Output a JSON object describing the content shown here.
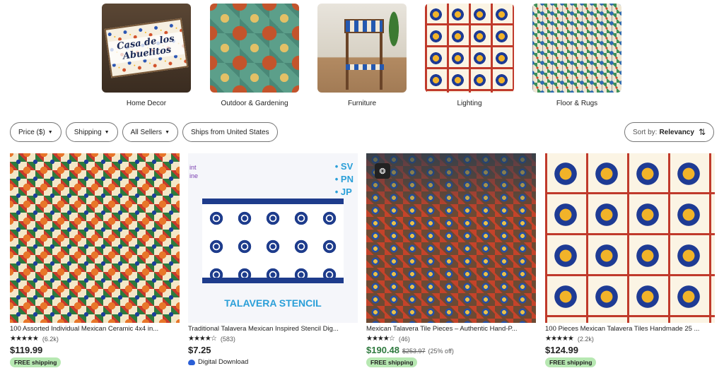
{
  "categories": [
    {
      "label": "Home Decor",
      "sign_text": "Casa de los Abuelitos"
    },
    {
      "label": "Outdoor & Gardening"
    },
    {
      "label": "Furniture"
    },
    {
      "label": "Lighting"
    },
    {
      "label": "Floor & Rugs"
    }
  ],
  "filters": [
    {
      "label": "Price ($)",
      "has_caret": true
    },
    {
      "label": "Shipping",
      "has_caret": true
    },
    {
      "label": "All Sellers",
      "has_caret": true
    },
    {
      "label": "Ships from United States",
      "has_caret": false
    }
  ],
  "sort": {
    "prefix": "Sort by:",
    "value": "Relevancy",
    "icon": "sort-arrows-icon"
  },
  "listings": [
    {
      "title": "100 Assorted Individual Mexican Ceramic 4x4 in...",
      "rating": 5,
      "review_count": "(6.2k)",
      "price": "$119.99",
      "original_price": "",
      "discount": "",
      "badge": "FREE shipping",
      "download": ""
    },
    {
      "title": "Traditional Talavera Mexican Inspired Stencil Dig...",
      "rating": 4.5,
      "review_count": "(583)",
      "price": "$7.25",
      "original_price": "",
      "discount": "",
      "badge": "",
      "download": "Digital Download",
      "image_caption": "TALAVERA STENCIL",
      "image_side_text": "• SV\n• PN\n• JP"
    },
    {
      "title": "Mexican Talavera Tile Pieces – Authentic Hand-P...",
      "rating": 4.5,
      "review_count": "(46)",
      "price": "$190.48",
      "original_price": "$253.97",
      "discount": "(25% off)",
      "badge": "FREE shipping",
      "download": ""
    },
    {
      "title": "100 Pieces Mexican Talavera Tiles Handmade 25 ...",
      "rating": 5,
      "review_count": "(2.2k)",
      "price": "$124.99",
      "original_price": "",
      "discount": "",
      "badge": "FREE shipping",
      "download": ""
    }
  ],
  "colors": {
    "sale_price": "#2f7a3f",
    "badge_bg": "#b7e8b2",
    "pill_border": "#757575"
  }
}
